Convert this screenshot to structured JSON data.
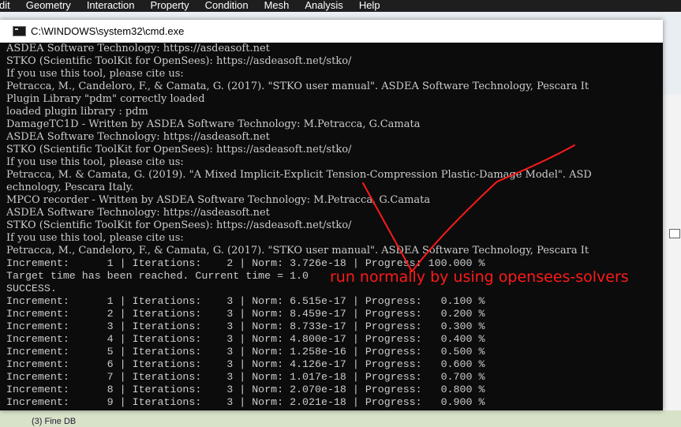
{
  "menubar": {
    "items": [
      "dit",
      "Geometry",
      "Interaction",
      "Property",
      "Condition",
      "Mesh",
      "Analysis",
      "Help"
    ]
  },
  "cmd": {
    "title": "C:\\WINDOWS\\system32\\cmd.exe",
    "lines": [
      "ASDEA Software Technology: https://asdeasoft.net",
      "STKO (Scientific ToolKit for OpenSees): https://asdeasoft.net/stko/",
      "If you use this tool, please cite us:",
      "Petracca, M., Candeloro, F., & Camata, G. (2017). \"STKO user manual\". ASDEA Software Technology, Pescara It",
      "Plugin Library \"pdm\" correctly loaded",
      "loaded plugin library : pdm",
      "DamageTC1D - Written by ASDEA Software Technology: M.Petracca, G.Camata",
      "ASDEA Software Technology: https://asdeasoft.net",
      "STKO (Scientific ToolKit for OpenSees): https://asdeasoft.net/stko/",
      "If you use this tool, please cite us:",
      "Petracca, M. & Camata, G. (2019). \"A Mixed Implicit-Explicit Tension-Compression Plastic-Damage Model\". ASD",
      "echnology, Pescara Italy.",
      "MPCO recorder - Written by ASDEA Software Technology: M.Petracca, G.Camata",
      "ASDEA Software Technology: https://asdeasoft.net",
      "STKO (Scientific ToolKit for OpenSees): https://asdeasoft.net/stko/",
      "If you use this tool, please cite us:",
      "Petracca, M., Candeloro, F., & Camata, G. (2017). \"STKO user manual\". ASDEA Software Technology, Pescara It",
      "Increment:      1 | Iterations:    2 | Norm: 3.726e-18 | Progress: 100.000 %",
      "Target time has been reached. Current time = 1.0",
      "SUCCESS.",
      "Increment:      1 | Iterations:    3 | Norm: 6.515e-17 | Progress:   0.100 %",
      "Increment:      2 | Iterations:    3 | Norm: 8.459e-17 | Progress:   0.200 %",
      "Increment:      3 | Iterations:    3 | Norm: 8.733e-17 | Progress:   0.300 %",
      "Increment:      4 | Iterations:    3 | Norm: 4.800e-17 | Progress:   0.400 %",
      "Increment:      5 | Iterations:    3 | Norm: 1.258e-16 | Progress:   0.500 %",
      "Increment:      6 | Iterations:    3 | Norm: 4.126e-17 | Progress:   0.600 %",
      "Increment:      7 | Iterations:    3 | Norm: 1.017e-18 | Progress:   0.700 %",
      "Increment:      8 | Iterations:    3 | Norm: 2.070e-18 | Progress:   0.800 %",
      "Increment:      9 | Iterations:    3 | Norm: 2.021e-18 | Progress:   0.900 %"
    ]
  },
  "annotation": {
    "text": "run normally  by using opensees-solvers",
    "color": "#ff1a1a"
  },
  "background": {
    "bottom_text": "(3) Fine DB"
  }
}
